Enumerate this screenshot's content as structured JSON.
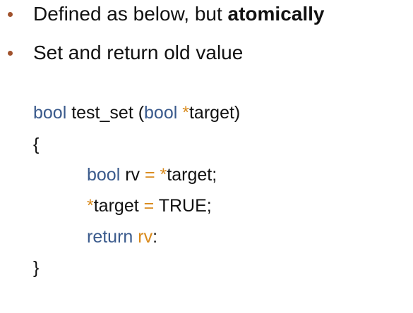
{
  "colors": {
    "bullet": "#a0522d",
    "keyword": "#3a5a8c",
    "operator": "#d98a1c",
    "text": "#111111"
  },
  "bullets": [
    {
      "text_plain": "Defined as below, but ",
      "text_bold": "atomically"
    },
    {
      "text_plain": "Set and return old value"
    }
  ],
  "code": {
    "line1": {
      "kw1": "bool",
      "text1": " test_set (",
      "kw2": "bool",
      "text2": " ",
      "op1": "*",
      "text3": "target)"
    },
    "line2": {
      "text": "{"
    },
    "line3": {
      "kw": "bool",
      "text1": " rv ",
      "op1": "=",
      "text2": " ",
      "op2": "*",
      "text3": "target;"
    },
    "line4": {
      "op1": "*",
      "text1": "target ",
      "op2": "=",
      "text2": " TRUE;"
    },
    "line5": {
      "kw": "return",
      "text1": " ",
      "op": "rv",
      "text2": ":"
    },
    "line6": {
      "text": "}"
    }
  }
}
